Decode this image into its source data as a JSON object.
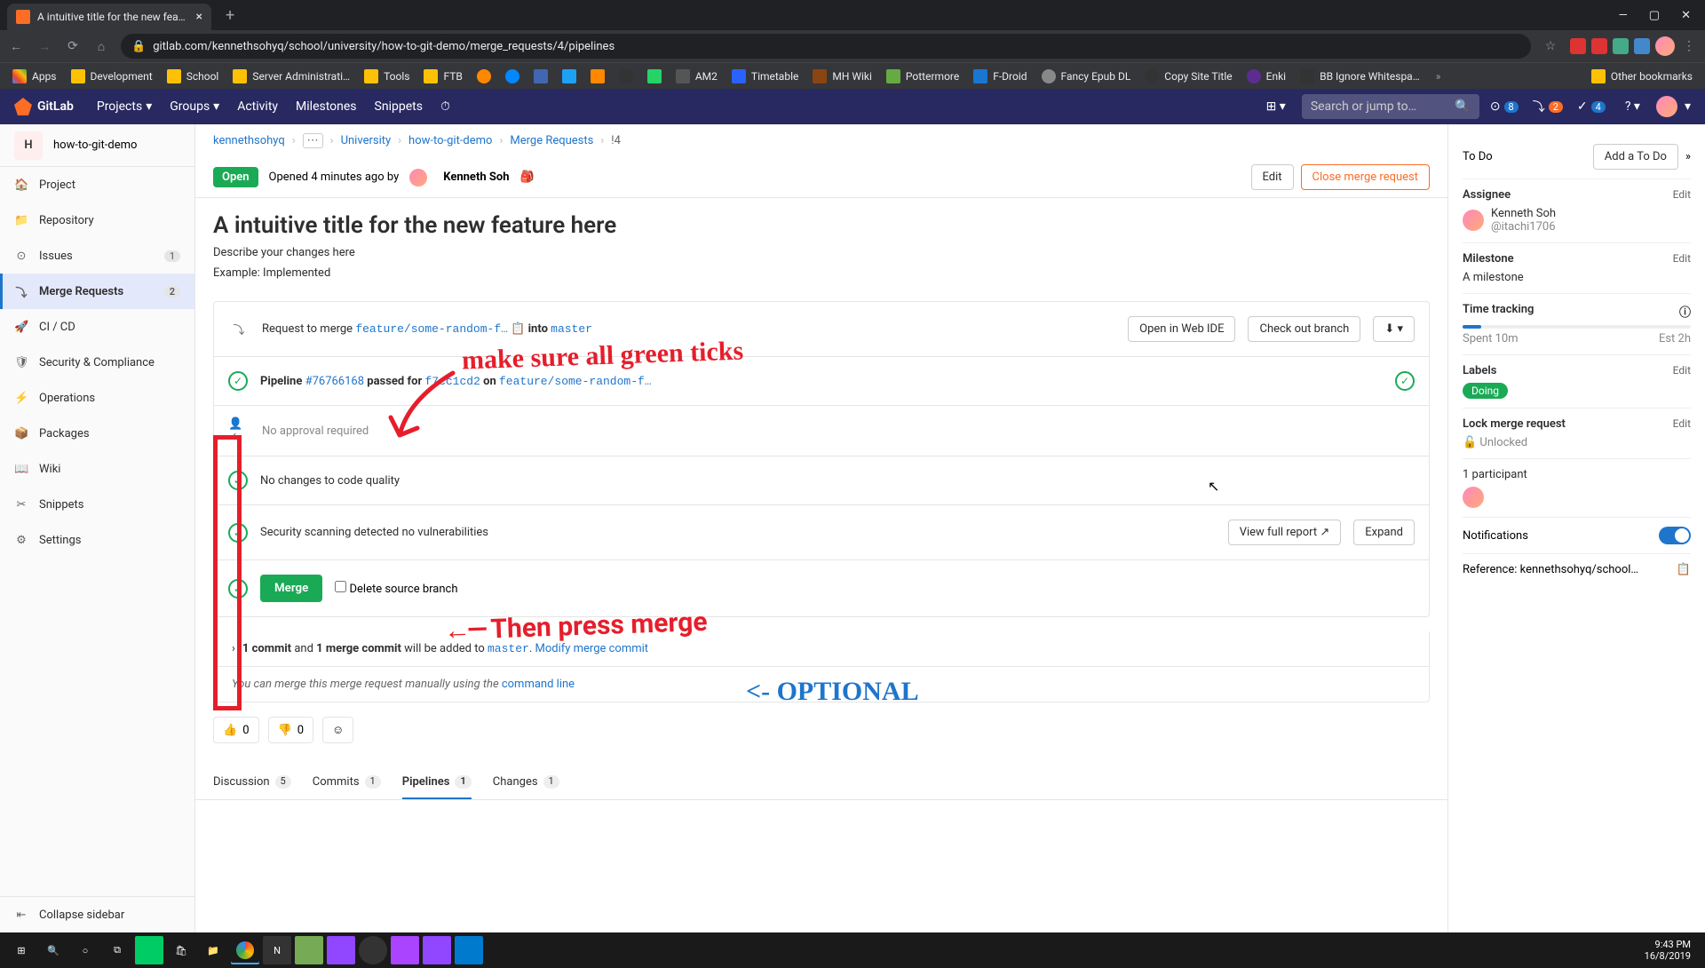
{
  "browser": {
    "tab_title": "A intuitive title for the new featu…",
    "url": "gitlab.com/kennethsohyq/school/university/how-to-git-demo/merge_requests/4/pipelines",
    "bookmarks": [
      "Apps",
      "Development",
      "School",
      "Server Administrati…",
      "Tools",
      "FTB",
      "AM2",
      "Timetable",
      "MH Wiki",
      "Pottermore",
      "F-Droid",
      "Fancy Epub DL",
      "Copy Site Title",
      "Enki",
      "BB Ignore Whitespa…"
    ],
    "other_bookmarks": "Other bookmarks"
  },
  "gitlab_nav": {
    "brand": "GitLab",
    "items": [
      "Projects",
      "Groups",
      "Activity",
      "Milestones",
      "Snippets"
    ],
    "search_placeholder": "Search or jump to…",
    "badges": {
      "issues": "8",
      "mrs": "2",
      "todos": "4"
    }
  },
  "sidebar": {
    "project_letter": "H",
    "project_name": "how-to-git-demo",
    "items": [
      {
        "icon": "🏠",
        "label": "Project"
      },
      {
        "icon": "📁",
        "label": "Repository"
      },
      {
        "icon": "⊙",
        "label": "Issues",
        "badge": "1"
      },
      {
        "icon": "⤵",
        "label": "Merge Requests",
        "badge": "2",
        "active": true
      },
      {
        "icon": "🚀",
        "label": "CI / CD"
      },
      {
        "icon": "🛡",
        "label": "Security & Compliance"
      },
      {
        "icon": "⚡",
        "label": "Operations"
      },
      {
        "icon": "📦",
        "label": "Packages"
      },
      {
        "icon": "📖",
        "label": "Wiki"
      },
      {
        "icon": "✂",
        "label": "Snippets"
      },
      {
        "icon": "⚙",
        "label": "Settings"
      }
    ],
    "collapse": "Collapse sidebar"
  },
  "breadcrumb": {
    "user": "kennethsohyq",
    "group": "University",
    "project": "how-to-git-demo",
    "section": "Merge Requests",
    "id": "!4"
  },
  "mr": {
    "status": "Open",
    "opened": "Opened 4 minutes ago by",
    "author": "Kenneth Soh",
    "edit": "Edit",
    "close": "Close merge request",
    "title": "A intuitive title for the new feature here",
    "desc1": "Describe your changes here",
    "desc2": "Example: Implemented",
    "request_merge": "Request to merge",
    "source_branch": "feature/some-random-f…",
    "into": "into",
    "target_branch": "master",
    "open_ide": "Open in Web IDE",
    "checkout": "Check out branch",
    "pipeline_label": "Pipeline",
    "pipeline_id": "#76766168",
    "pipeline_status": "passed for",
    "commit_sha": "f7cc1cd2",
    "on": "on",
    "pipeline_branch": "feature/some-random-f…",
    "approval": "No approval required",
    "code_quality": "No changes to code quality",
    "security": "Security scanning detected no vulnerabilities",
    "view_full": "View full report",
    "expand": "Expand",
    "merge_btn": "Merge",
    "delete_branch": "Delete source branch",
    "commit_info_1": "1 commit",
    "commit_info_and": "and",
    "commit_info_2": "1 merge commit",
    "commit_info_3": "will be added to",
    "commit_target": "master",
    "modify_commit": "Modify merge commit",
    "manual_merge": "You can merge this merge request manually using the",
    "cmdline": "command line",
    "thumbs_up": "0",
    "thumbs_down": "0"
  },
  "tabs": [
    {
      "label": "Discussion",
      "count": "5"
    },
    {
      "label": "Commits",
      "count": "1"
    },
    {
      "label": "Pipelines",
      "count": "1",
      "active": true
    },
    {
      "label": "Changes",
      "count": "1"
    }
  ],
  "rsidebar": {
    "todo_title": "To Do",
    "add_todo": "Add a To Do",
    "assignee_h": "Assignee",
    "assignee_name": "Kenneth Soh",
    "assignee_handle": "@itachi1706",
    "milestone_h": "Milestone",
    "milestone_v": "A milestone",
    "time_h": "Time tracking",
    "spent": "Spent 10m",
    "est": "Est 2h",
    "labels_h": "Labels",
    "label_v": "Doing",
    "lock_h": "Lock merge request",
    "lock_v": "Unlocked",
    "participants": "1 participant",
    "notif": "Notifications",
    "reference_h": "Reference:",
    "reference_v": "kennethsohyq/school…",
    "edit": "Edit"
  },
  "annotations": {
    "a1": "make sure all green ticks",
    "a2": "Then press merge",
    "a3": "<- OPTIONAL"
  },
  "taskbar": {
    "time": "9:43 PM",
    "date": "16/8/2019"
  }
}
